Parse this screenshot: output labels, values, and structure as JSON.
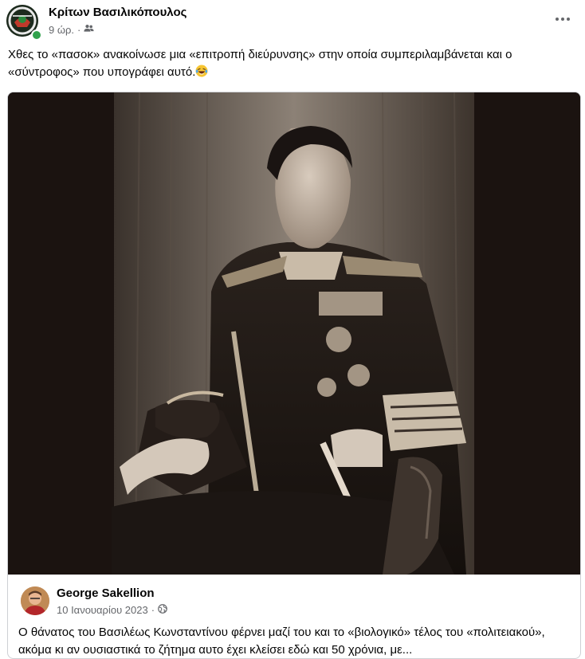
{
  "post": {
    "author": "Κρίτων Βασιλικόπουλος",
    "time": "9 ώρ.",
    "separator": "·",
    "audience_icon": "friends-icon",
    "more_icon": "more-options-icon",
    "text": "Χθες το «πασοκ» ανακοίνωσε μια «επιτροπή διεύρυνσης» στην οποία συμπεριλαμβάνεται και ο «σύντροφος» που υπογράφει αυτό.",
    "emoji": "laughing-tears-emoji"
  },
  "shared_post": {
    "author": "George Sakellion",
    "date": "10 Ιανουαρίου 2023",
    "separator": "·",
    "audience_icon": "globe-icon",
    "text": "Ο θάνατος του Βασιλέως Κωνσταντίνου φέρνει μαζί του και το «βιολογικό» τέλος του «πολιτειακού», ακόμα κι αν ουσιαστικά το ζήτημα αυτο έχει κλείσει εδώ και 50 χρόνια, με..."
  },
  "colors": {
    "online": "#31a24c",
    "secondary_text": "#65676b",
    "border": "#ced0d4"
  }
}
